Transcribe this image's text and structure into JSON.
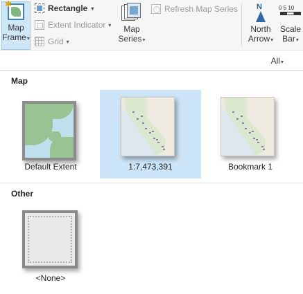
{
  "ribbon": {
    "map_frame": {
      "line1": "Map",
      "line2": "Frame"
    },
    "rectangle": "Rectangle",
    "extent_indicator": "Extent Indicator",
    "grid": "Grid",
    "map_series": {
      "line1": "Map",
      "line2": "Series"
    },
    "refresh_map_series": "Refresh Map Series",
    "north_arrow": {
      "line1": "North",
      "line2": "Arrow"
    },
    "scale_bar": {
      "line1": "Scale",
      "line2": "Bar",
      "ticks": "0 5 10"
    }
  },
  "filter": {
    "label": "All"
  },
  "gallery": {
    "sections": [
      {
        "title": "Map",
        "items": [
          "Default Extent",
          "1:7,473,391",
          "Bookmark 1"
        ]
      },
      {
        "title": "Other",
        "items": [
          "<None>"
        ]
      }
    ],
    "selected_item": "1:7,473,391"
  },
  "colors": {
    "selected_tile": "#cce4f7",
    "map_frame_active": "#cfe6f6",
    "north_arrow": "#2f6aa6"
  }
}
